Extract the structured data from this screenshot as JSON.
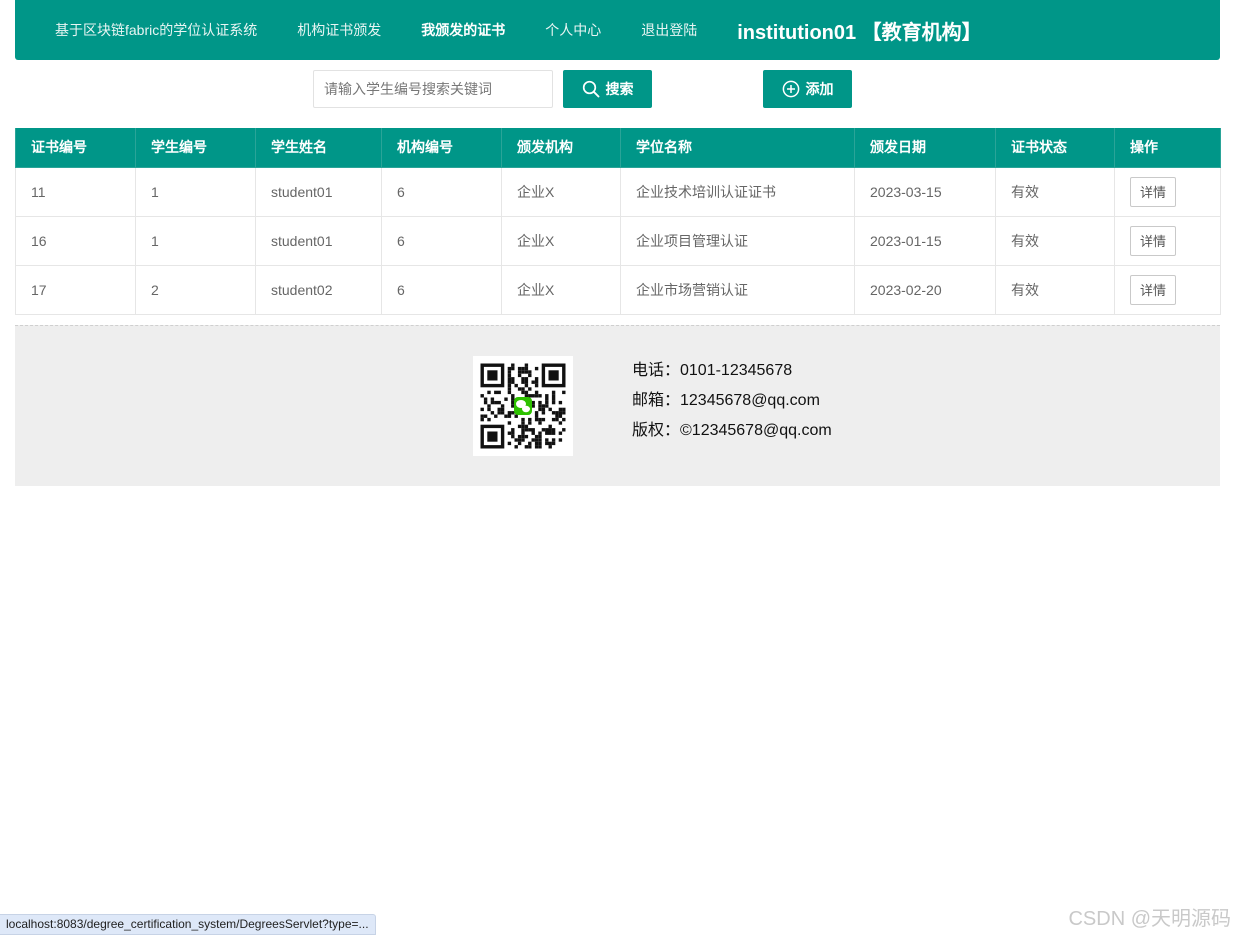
{
  "nav": {
    "items": [
      "基于区块链fabric的学位认证系统",
      "机构证书颁发",
      "我颁发的证书",
      "个人中心",
      "退出登陆"
    ],
    "active_index": 2,
    "user": "institution01 【教育机构】"
  },
  "search": {
    "placeholder": "请输入学生编号搜索关键词",
    "value": ""
  },
  "buttons": {
    "search": "搜索",
    "add": "添加",
    "search_icon": "search-icon",
    "add_icon": "plus-circle-icon"
  },
  "table": {
    "headers": [
      "证书编号",
      "学生编号",
      "学生姓名",
      "机构编号",
      "颁发机构",
      "学位名称",
      "颁发日期",
      "证书状态",
      "操作"
    ],
    "rows": [
      [
        "11",
        "1",
        "student01",
        "6",
        "企业X",
        "企业技术培训认证证书",
        "2023-03-15",
        "有效"
      ],
      [
        "16",
        "1",
        "student01",
        "6",
        "企业X",
        "企业项目管理认证",
        "2023-01-15",
        "有效"
      ],
      [
        "17",
        "2",
        "student02",
        "6",
        "企业X",
        "企业市场营销认证",
        "2023-02-20",
        "有效"
      ]
    ],
    "action_label": "详情"
  },
  "footer": {
    "qr_icon": "wechat-qr-icon",
    "phone": "电话：0101-12345678",
    "email": "邮箱：12345678@qq.com",
    "copyright": "版权：©12345678@qq.com"
  },
  "statusbar": "localhost:8083/degree_certification_system/DegreesServlet?type=...",
  "watermark": "CSDN @天明源码",
  "colors": {
    "primary": "#009688",
    "footer_bg": "#eeeeee",
    "wechat_green": "#2dc100"
  }
}
